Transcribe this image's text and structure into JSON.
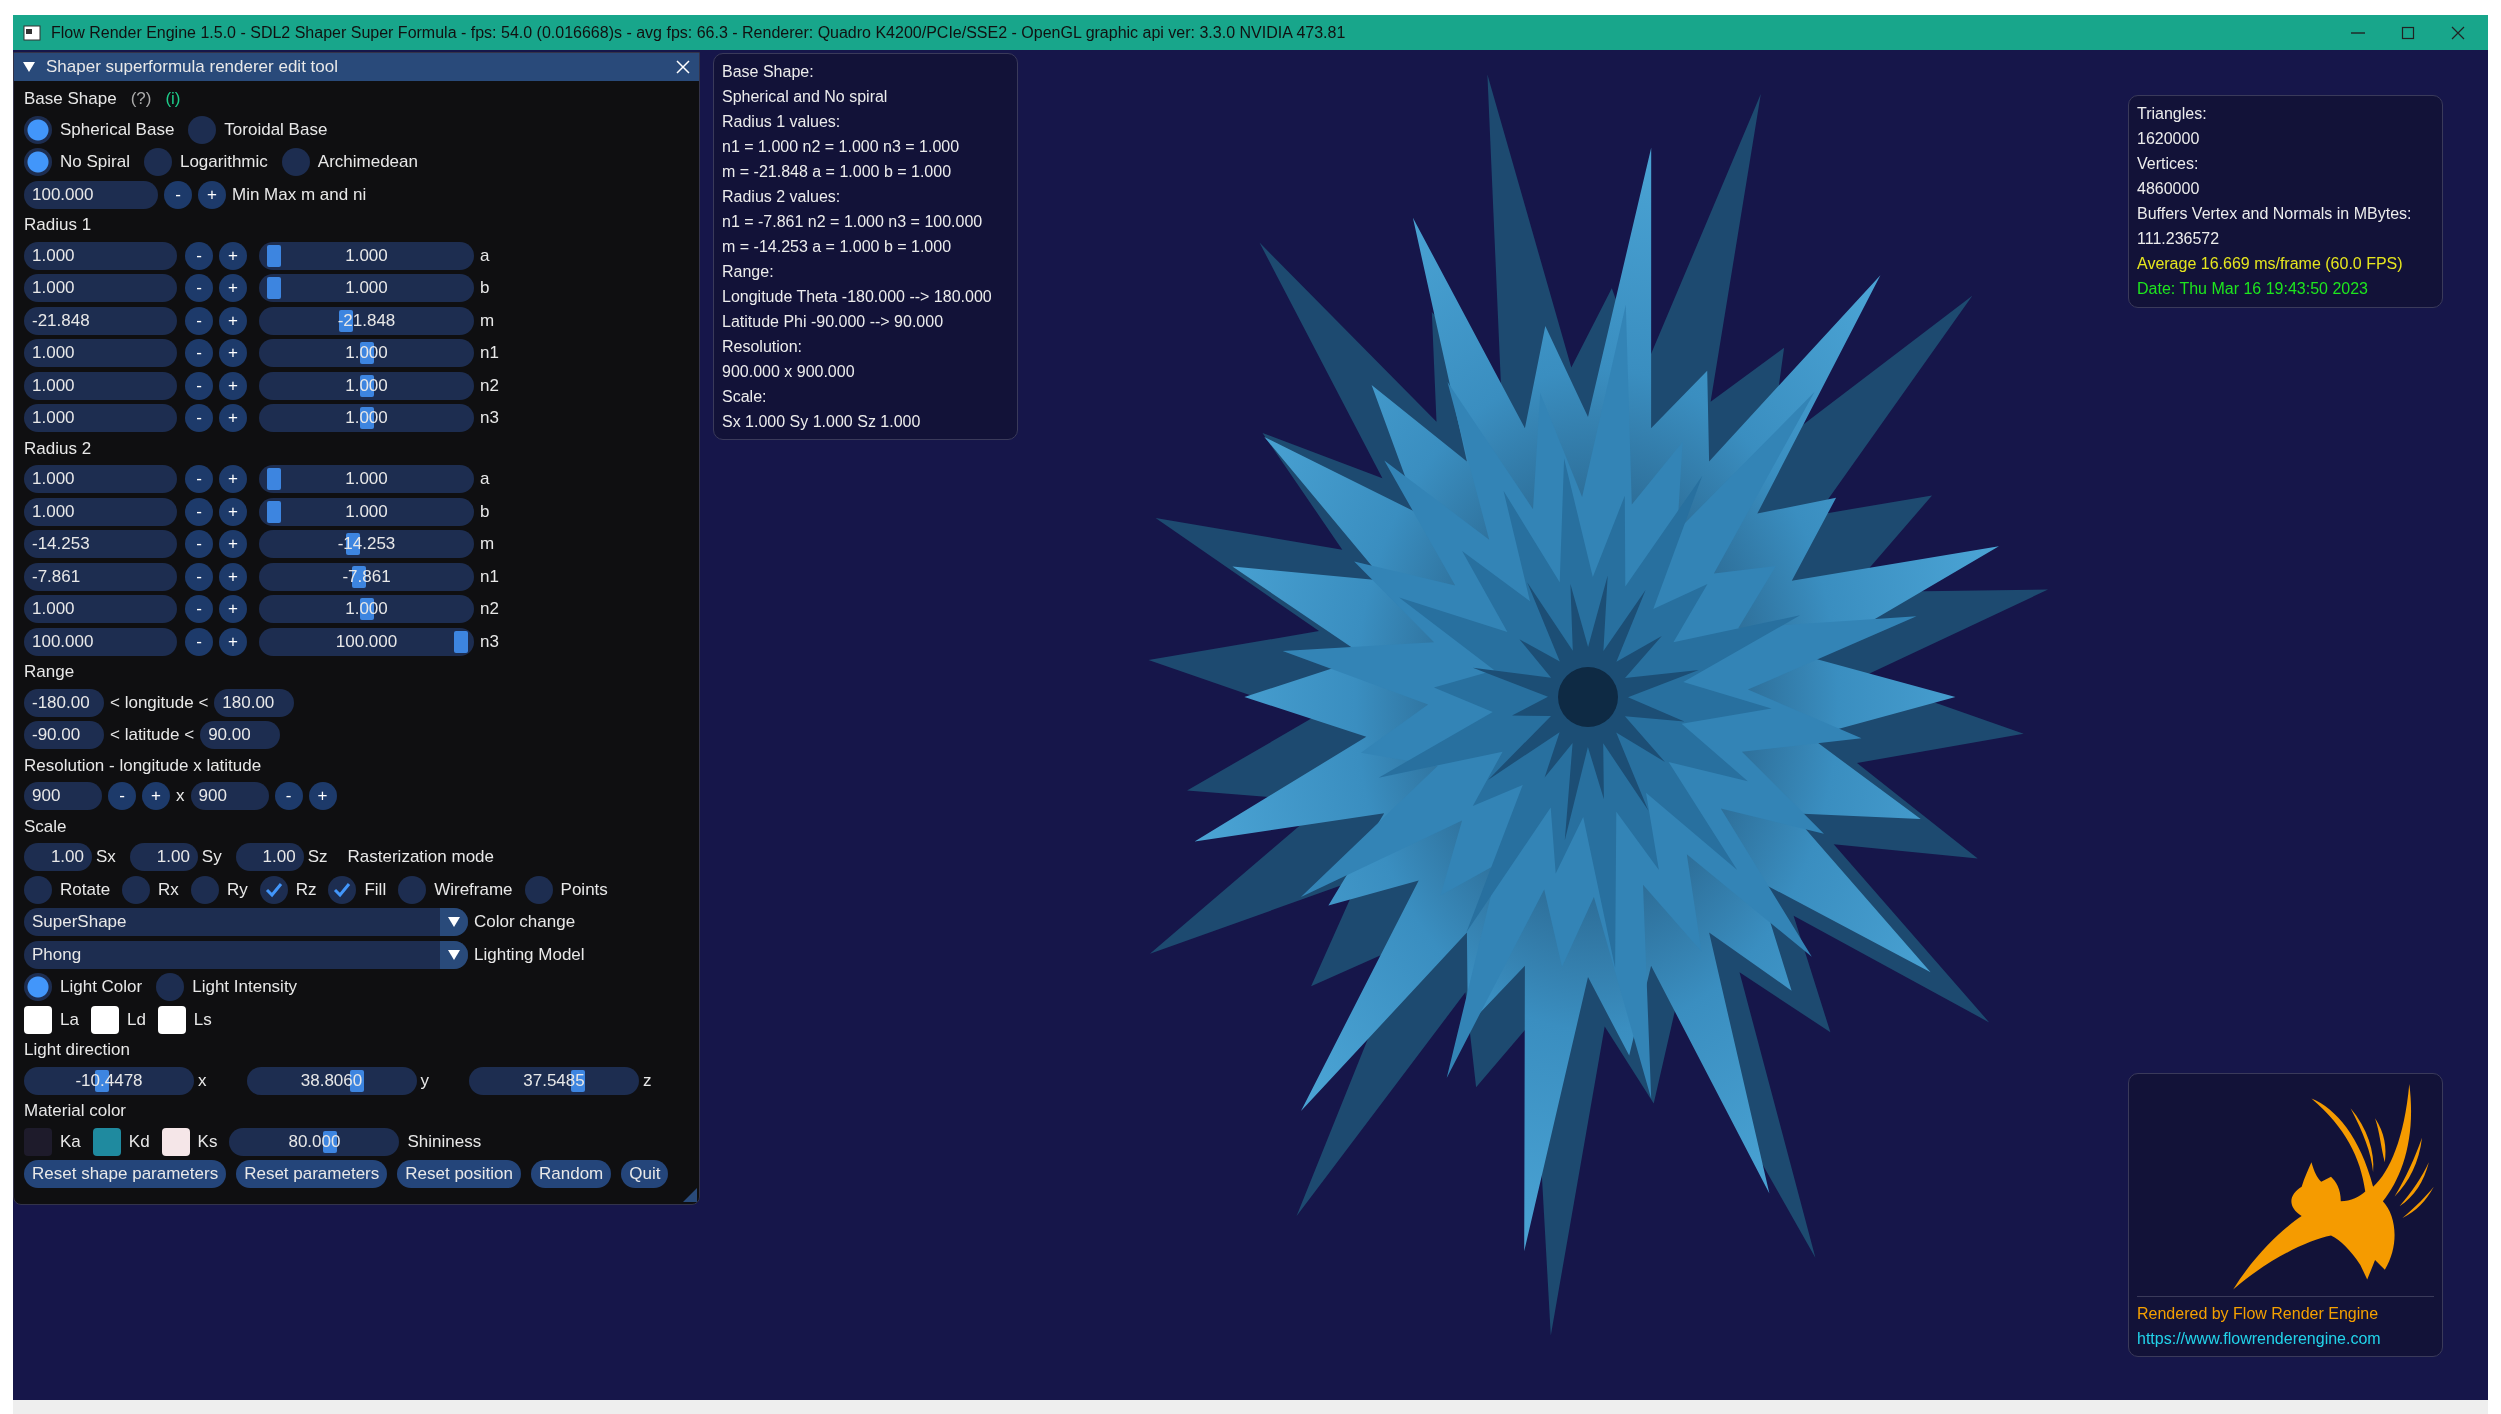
{
  "window": {
    "title": "Flow Render Engine 1.5.0 - SDL2 Shaper Super Formula - fps: 54.0 (0.016668)s - avg fps: 66.3 - Renderer: Quadro K4200/PCIe/SSE2 - OpenGL graphic api ver: 3.3.0 NVIDIA 473.81"
  },
  "edit_tool": {
    "title": "Shaper superformula renderer edit tool",
    "expanded": true,
    "base_shape": {
      "label": "Base Shape",
      "help": "(?)",
      "info": "(i)"
    },
    "base_options": [
      {
        "label": "Spherical Base",
        "selected": true
      },
      {
        "label": "Toroidal Base",
        "selected": false
      }
    ],
    "spiral_options": [
      {
        "label": "No Spiral",
        "selected": true
      },
      {
        "label": "Logarithmic",
        "selected": false
      },
      {
        "label": "Archimedean",
        "selected": false
      }
    ],
    "min_max": {
      "value": "100.000",
      "minus": "-",
      "plus": "+",
      "label": "Min Max m and ni"
    },
    "radius_groups": [
      {
        "heading": "Radius 1",
        "params": [
          {
            "value": "1.000",
            "minus": "-",
            "plus": "+",
            "slider_value": "1.000",
            "level": 0.01,
            "label": "a"
          },
          {
            "value": "1.000",
            "minus": "-",
            "plus": "+",
            "slider_value": "1.000",
            "level": 0.01,
            "label": "b"
          },
          {
            "value": "-21.848",
            "minus": "-",
            "plus": "+",
            "slider_value": "-21.848",
            "level": 0.39,
            "label": "m"
          },
          {
            "value": "1.000",
            "minus": "-",
            "plus": "+",
            "slider_value": "1.000",
            "level": 0.505,
            "label": "n1"
          },
          {
            "value": "1.000",
            "minus": "-",
            "plus": "+",
            "slider_value": "1.000",
            "level": 0.505,
            "label": "n2"
          },
          {
            "value": "1.000",
            "minus": "-",
            "plus": "+",
            "slider_value": "1.000",
            "level": 0.505,
            "label": "n3"
          }
        ]
      },
      {
        "heading": "Radius 2",
        "params": [
          {
            "value": "1.000",
            "minus": "-",
            "plus": "+",
            "slider_value": "1.000",
            "level": 0.01,
            "label": "a"
          },
          {
            "value": "1.000",
            "minus": "-",
            "plus": "+",
            "slider_value": "1.000",
            "level": 0.01,
            "label": "b"
          },
          {
            "value": "-14.253",
            "minus": "-",
            "plus": "+",
            "slider_value": "-14.253",
            "level": 0.43,
            "label": "m"
          },
          {
            "value": "-7.861",
            "minus": "-",
            "plus": "+",
            "slider_value": "-7.861",
            "level": 0.46,
            "label": "n1"
          },
          {
            "value": "1.000",
            "minus": "-",
            "plus": "+",
            "slider_value": "1.000",
            "level": 0.505,
            "label": "n2"
          },
          {
            "value": "100.000",
            "minus": "-",
            "plus": "+",
            "slider_value": "100.000",
            "level": 1.0,
            "label": "n3"
          }
        ]
      }
    ],
    "range": {
      "heading": "Range",
      "rows": [
        {
          "min": "-180.00",
          "label": "< longitude <",
          "max": "180.00"
        },
        {
          "min": "-90.00",
          "label": "< latitude <",
          "max": "90.00"
        }
      ]
    },
    "resolution": {
      "heading": "Resolution - longitude x latitude",
      "fields": [
        {
          "value": "900",
          "minus": "-",
          "plus": "+"
        },
        {
          "value": "900",
          "minus": "-",
          "plus": "+"
        }
      ],
      "separator": "x"
    },
    "scale": {
      "heading": "Scale",
      "fields": [
        {
          "value": "1.00",
          "label": "Sx"
        },
        {
          "value": "1.00",
          "label": "Sy"
        },
        {
          "value": "1.00",
          "label": "Sz"
        }
      ],
      "raster_label": "Rasterization mode"
    },
    "toggles": [
      {
        "label": "Rotate",
        "checked": false
      },
      {
        "label": "Rx",
        "checked": false
      },
      {
        "label": "Ry",
        "checked": false
      },
      {
        "label": "Rz",
        "checked": true
      },
      {
        "label": "Fill",
        "checked": true
      },
      {
        "label": "Wireframe",
        "checked": false
      },
      {
        "label": "Points",
        "checked": false
      }
    ],
    "dropdowns": [
      {
        "value": "SuperShape",
        "label": "Color change"
      },
      {
        "value": "Phong",
        "label": "Lighting Model"
      }
    ],
    "light_modes": [
      {
        "label": "Light Color",
        "selected": true
      },
      {
        "label": "Light Intensity",
        "selected": false
      }
    ],
    "light_colors": [
      {
        "label": "La",
        "color": "#ffffff"
      },
      {
        "label": "Ld",
        "color": "#ffffff"
      },
      {
        "label": "Ls",
        "color": "#ffffff"
      }
    ],
    "light_direction": {
      "heading": "Light direction",
      "sliders": [
        {
          "value": "-10.4478",
          "level": 0.45,
          "axis": "x"
        },
        {
          "value": "38.8060",
          "level": 0.68,
          "axis": "y"
        },
        {
          "value": "37.5485",
          "level": 0.67,
          "axis": "z"
        }
      ]
    },
    "material": {
      "heading": "Material color",
      "colors": [
        {
          "label": "Ka",
          "color": "#1e1b2b"
        },
        {
          "label": "Kd",
          "color": "#1f8a9f"
        },
        {
          "label": "Ks",
          "color": "#f5e6e8"
        }
      ],
      "shininess": {
        "value": "80.000",
        "level": 0.61,
        "label": "Shininess"
      }
    },
    "buttons": [
      "Reset shape parameters",
      "Reset parameters",
      "Reset position",
      "Random",
      "Quit"
    ]
  },
  "shape_info": {
    "lines": [
      "Base Shape:",
      "Spherical and No spiral",
      "Radius 1 values:",
      "n1 = 1.000 n2 = 1.000 n3 = 1.000",
      "m = -21.848 a = 1.000 b = 1.000",
      "Radius 2 values:",
      "n1 = -7.861 n2 = 1.000 n3 = 100.000",
      "m = -14.253 a = 1.000 b = 1.000",
      "Range:",
      "Longitude Theta -180.000 --> 180.000",
      "Latitude Phi -90.000 --> 90.000",
      "Resolution:",
      "900.000 x 900.000",
      "Scale:",
      "Sx 1.000 Sy 1.000 Sz 1.000"
    ]
  },
  "stats": {
    "lines": [
      {
        "text": "Triangles:",
        "kind": "label"
      },
      {
        "text": "1620000",
        "kind": "value"
      },
      {
        "text": "Vertices:",
        "kind": "label"
      },
      {
        "text": "4860000",
        "kind": "value"
      },
      {
        "text": "Buffers Vertex and Normals in MBytes:",
        "kind": "label"
      },
      {
        "text": "111.236572",
        "kind": "value"
      },
      {
        "text": "Average 16.669 ms/frame (60.0 FPS)",
        "kind": "timing"
      },
      {
        "text": "Date: Thu Mar 16 19:43:50 2023",
        "kind": "date"
      }
    ]
  },
  "credits": {
    "text": "Rendered by Flow Render Engine",
    "link": "https://www.flowrenderengine.com"
  }
}
